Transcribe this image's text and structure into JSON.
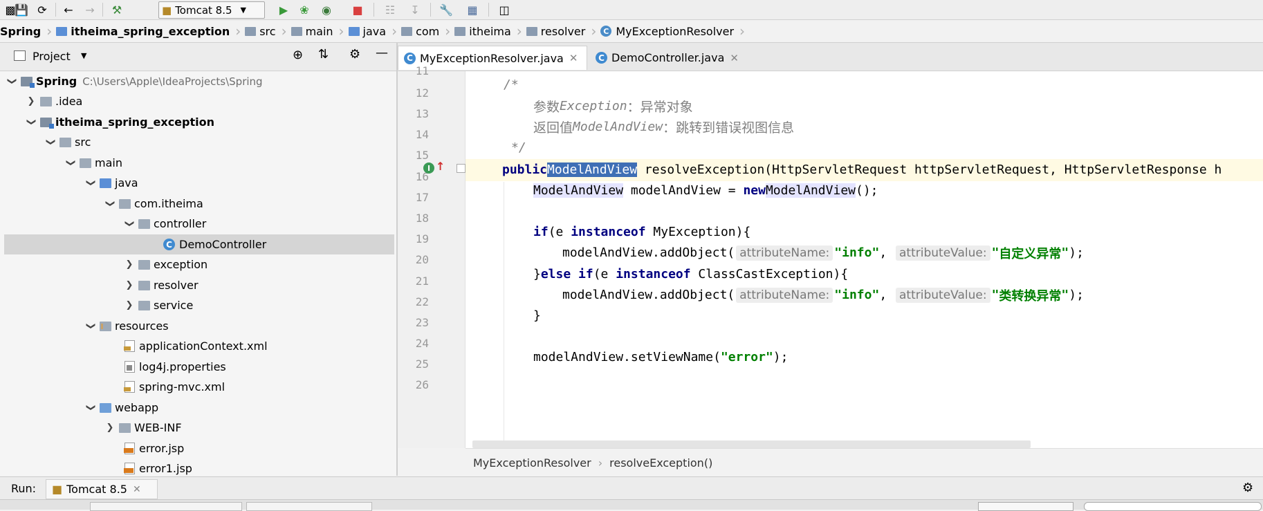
{
  "toolbar": {
    "run_config": "Tomcat 8.5"
  },
  "breadcrumb": [
    "Spring",
    "itheima_spring_exception",
    "src",
    "main",
    "java",
    "com",
    "itheima",
    "resolver",
    "MyExceptionResolver"
  ],
  "project_panel": {
    "title": "Project",
    "tree": [
      {
        "label": "Spring",
        "path": "C:\\Users\\Apple\\IdeaProjects\\Spring"
      },
      {
        "label": ".idea"
      },
      {
        "label": "itheima_spring_exception"
      },
      {
        "label": "src"
      },
      {
        "label": "main"
      },
      {
        "label": "java"
      },
      {
        "label": "com.itheima"
      },
      {
        "label": "controller"
      },
      {
        "label": "DemoController"
      },
      {
        "label": "exception"
      },
      {
        "label": "resolver"
      },
      {
        "label": "service"
      },
      {
        "label": "resources"
      },
      {
        "label": "applicationContext.xml"
      },
      {
        "label": "log4j.properties"
      },
      {
        "label": "spring-mvc.xml"
      },
      {
        "label": "webapp"
      },
      {
        "label": "WEB-INF"
      },
      {
        "label": "error.jsp"
      },
      {
        "label": "error1.jsp"
      }
    ]
  },
  "editor": {
    "tabs": [
      {
        "label": "MyExceptionResolver.java",
        "active": true
      },
      {
        "label": "DemoController.java",
        "active": false
      }
    ],
    "line_numbers": [
      "11",
      "12",
      "13",
      "14",
      "15",
      "16",
      "17",
      "18",
      "19",
      "20",
      "21",
      "22",
      "23",
      "24",
      "25",
      "26"
    ],
    "code": {
      "l12": "/*",
      "l13_a": "参数",
      "l13_b": "Exception",
      "l13_c": "：异常对象",
      "l14_a": "返回值",
      "l14_b": "ModelAndView",
      "l14_c": "：跳转到错误视图信息",
      "l15": "*/",
      "l16_kw": "public",
      "l16_type": "ModelAndView",
      "l16_rest": " resolveException(HttpServletRequest httpServletRequest, HttpServletResponse h",
      "l17_type": "ModelAndView",
      "l17_mid": " modelAndView = ",
      "l17_new": "new",
      "l17_ctor": "ModelAndView",
      "l17_end": "();",
      "l19_if": "if",
      "l19_a": "(e ",
      "l19_inst": "instanceof",
      "l19_b": " MyException){",
      "l20_a": "modelAndView.addObject(",
      "hint_name": "attributeName:",
      "l20_str1": "\"info\"",
      "l20_comma": ", ",
      "hint_value": "attributeValue:",
      "l20_str2_q": "\"",
      "l20_str2": "自定义异常",
      "l20_end": ");",
      "l21_a": "}",
      "l21_else": "else if",
      "l21_b": "(e ",
      "l21_inst": "instanceof",
      "l21_c": " ClassCastException){",
      "l22_a": "modelAndView.addObject(",
      "l22_str1": "\"info\"",
      "l22_str2": "类转换异常",
      "l22_end": ");",
      "l23": "}",
      "l25_a": "modelAndView.setViewName(",
      "l25_str": "\"error\"",
      "l25_end": ");"
    },
    "status_crumbs": [
      "MyExceptionResolver",
      "resolveException()"
    ]
  },
  "run_bar": {
    "label": "Run:",
    "tab": "Tomcat 8.5"
  }
}
